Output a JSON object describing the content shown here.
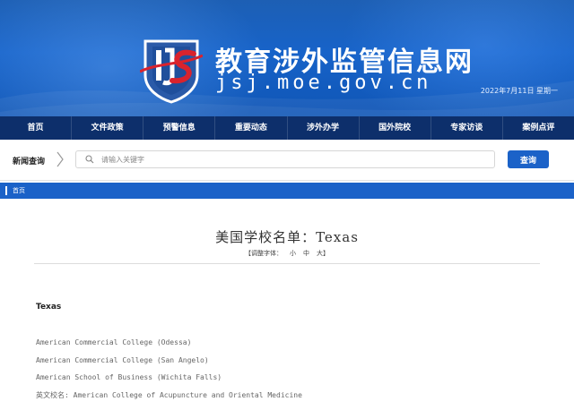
{
  "header": {
    "site_title": "教育涉外监管信息网",
    "site_domain": "jsj.moe.gov.cn",
    "date": "2022年7月11日 星期一",
    "colors": {
      "banner": "#1763c9",
      "nav": "#0d2f6b",
      "accent": "#1b62c8",
      "logo_red": "#d9232d"
    }
  },
  "nav": {
    "items": [
      "首页",
      "文件政策",
      "预警信息",
      "重要动态",
      "涉外办学",
      "国外院校",
      "专家访谈",
      "案例点评"
    ]
  },
  "search": {
    "label": "新闻查询",
    "placeholder": "请输入关键字",
    "button_label": "查询"
  },
  "breadcrumb": {
    "home": "首页"
  },
  "article": {
    "title": "美国学校名单：Texas",
    "font_size_label": "【调整字体：",
    "font_small": "小",
    "font_medium": "中",
    "font_large": "大】",
    "state_heading": "Texas",
    "schools": [
      "American Commercial College (Odessa)",
      "American Commercial College (San Angelo)",
      "American School of Business (Wichita Falls)",
      "英文校名: American College of Acupuncture and Oriental Medicine"
    ]
  }
}
